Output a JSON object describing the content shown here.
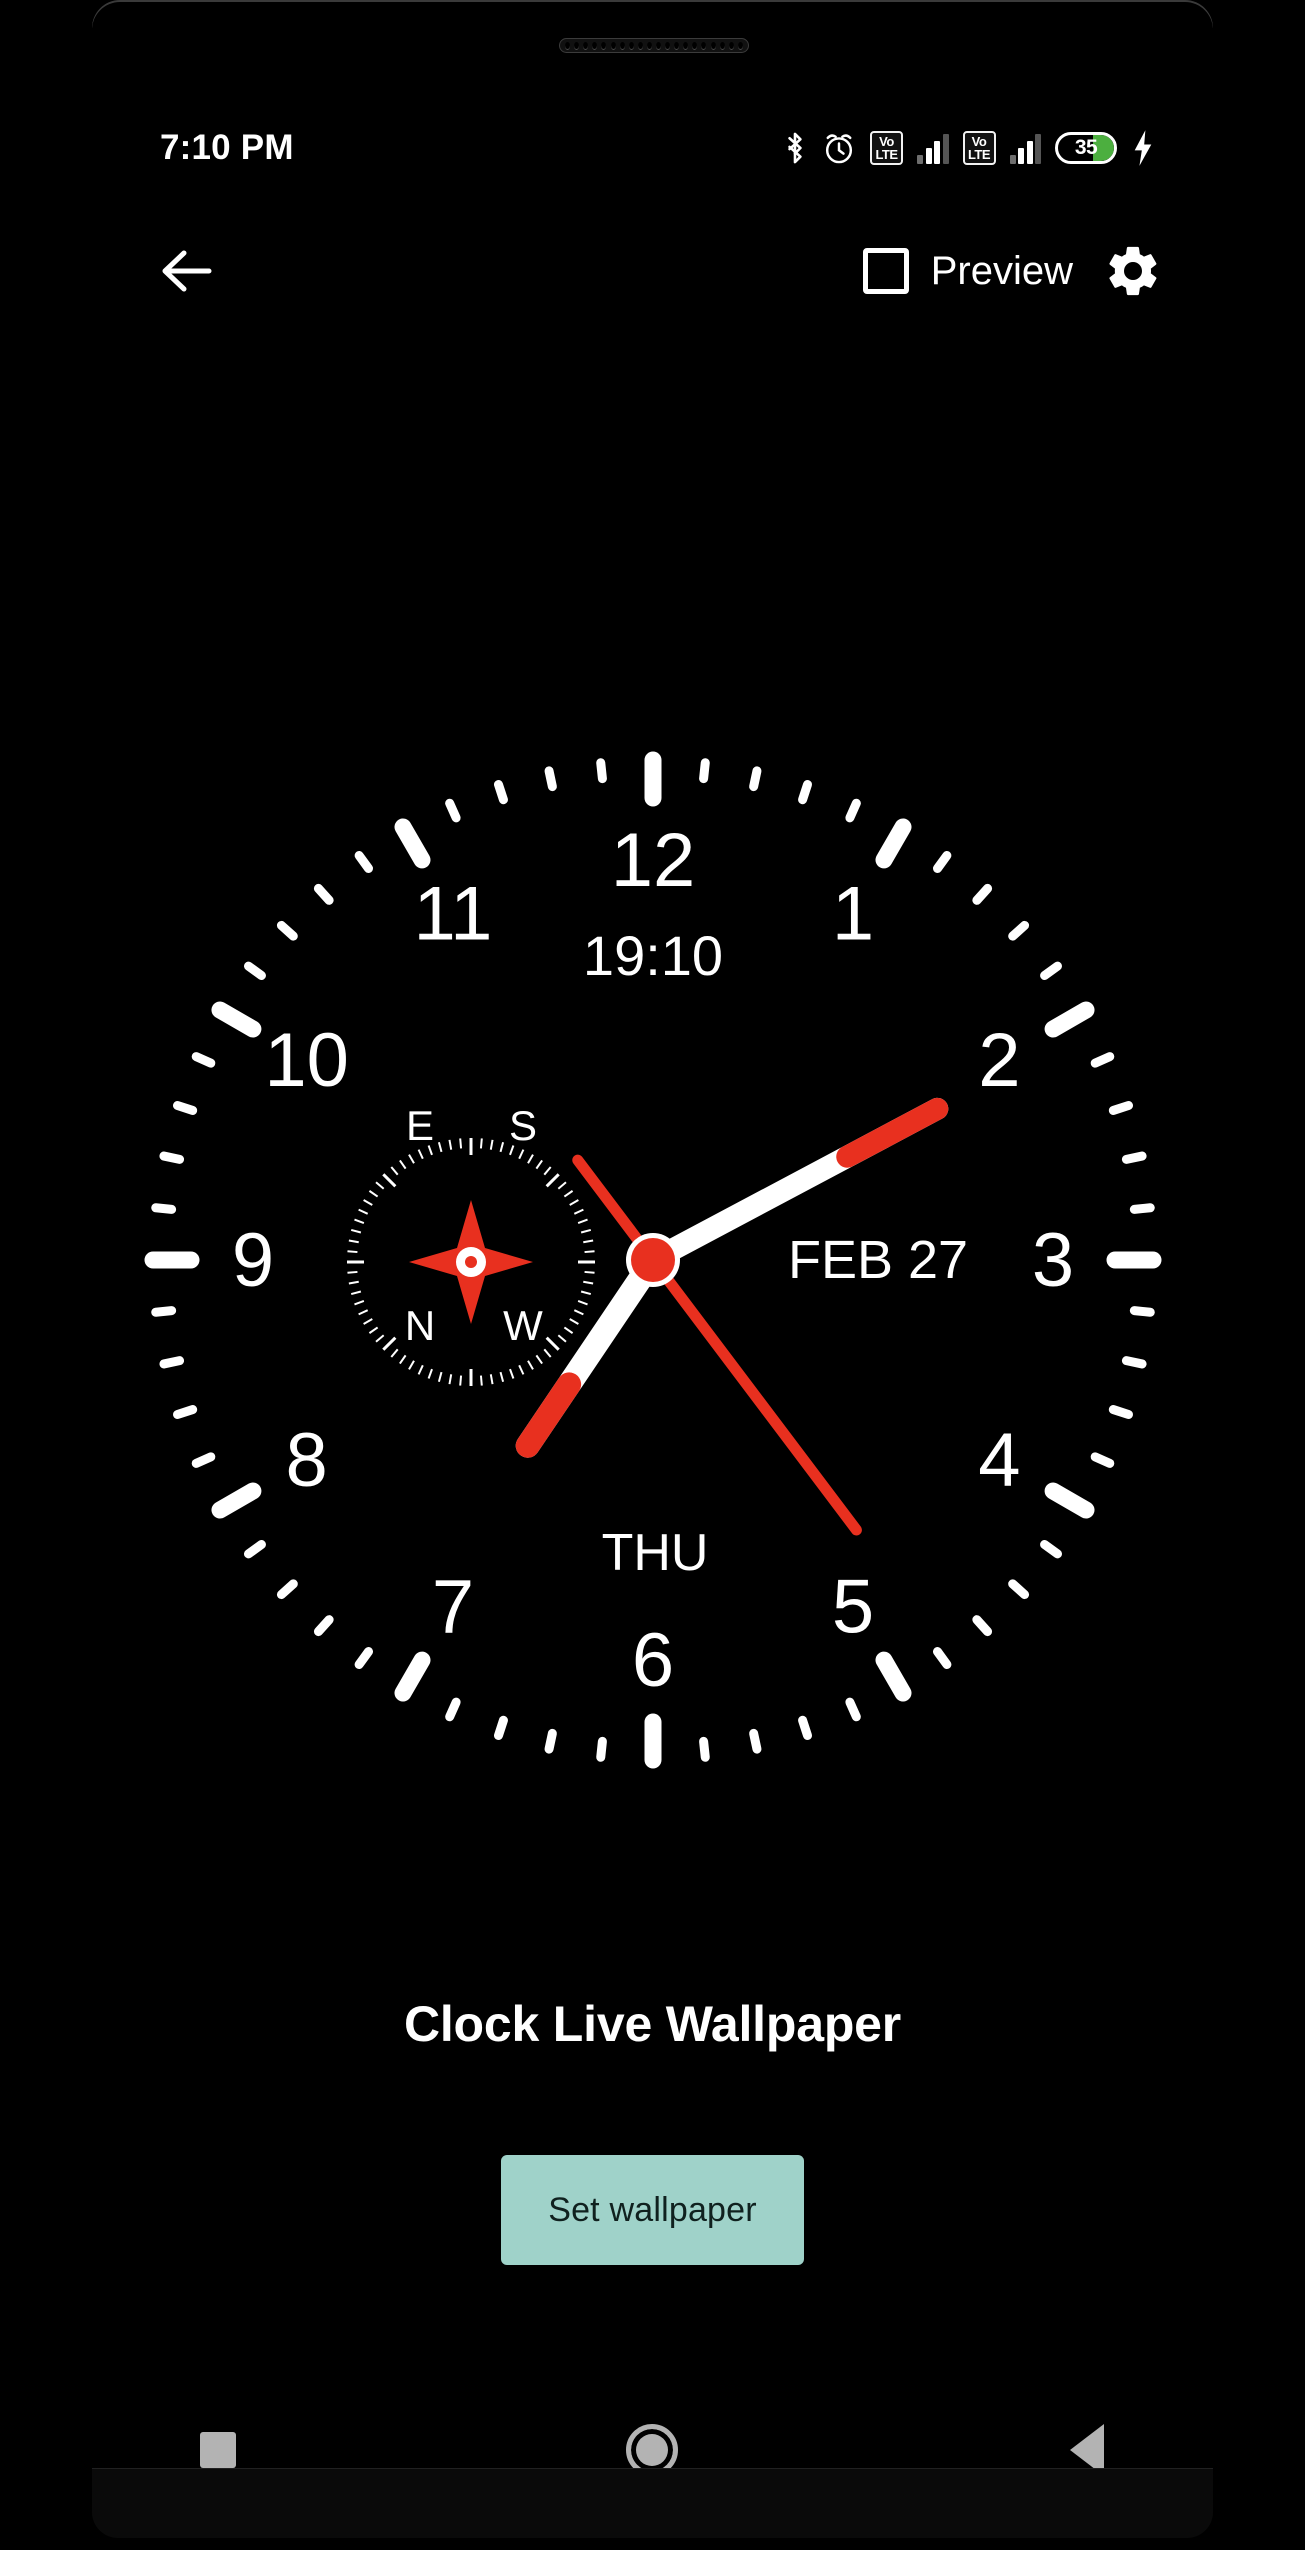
{
  "status_bar": {
    "clock": "7:10 PM",
    "icons": [
      {
        "name": "bluetooth-icon"
      },
      {
        "name": "alarm-icon"
      },
      {
        "name": "volte-icon-sim1",
        "top": "Vo",
        "bottom": "LTE"
      },
      {
        "name": "signal-bars-icon-sim1"
      },
      {
        "name": "volte-icon-sim2",
        "top": "Vo",
        "bottom": "LTE"
      },
      {
        "name": "signal-bars-icon-sim2"
      },
      {
        "name": "battery-icon"
      },
      {
        "name": "charging-bolt-icon"
      }
    ],
    "battery_level": "35",
    "battery_fill_color": "#4caf3f"
  },
  "action_bar": {
    "back_icon": "arrow-left-icon",
    "preview_label": "Preview",
    "preview_checked": false,
    "settings_icon": "gear-icon"
  },
  "clock": {
    "digital_time": "19:10",
    "date": "FEB 27",
    "weekday": "THU",
    "hour_numerals": [
      "12",
      "1",
      "2",
      "3",
      "4",
      "5",
      "6",
      "7",
      "8",
      "9",
      "10",
      "11"
    ],
    "hand_angles": {
      "hour": 214,
      "minute": 62,
      "second": 143
    },
    "hand_color": "#ffffff",
    "accent_color": "#e8301f",
    "dial_color": "#000000",
    "compass": {
      "labels": {
        "top_left": "E",
        "top_right": "S",
        "bottom_left": "N",
        "bottom_right": "W"
      },
      "needle_color": "#e8301f"
    }
  },
  "content": {
    "title": "Clock Live Wallpaper",
    "set_wallpaper_label": "Set wallpaper",
    "button_color": "#9fd2c9"
  },
  "nav_bar": {
    "recents_icon": "square-recents-icon",
    "home_icon": "circle-home-icon",
    "back_icon": "triangle-back-icon"
  }
}
